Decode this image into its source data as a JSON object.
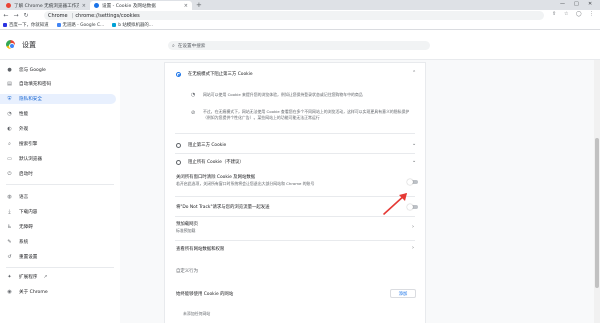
{
  "tabs": [
    {
      "label": "了解 Chrome 无痕浏览器工作方式",
      "close": "×"
    },
    {
      "label": "设置 - Cookie 及网站数据",
      "close": "×"
    }
  ],
  "new_tab": "+",
  "window_controls": {
    "minimize": "—",
    "maximize": "□",
    "close": "✕"
  },
  "toolbar": {
    "back": "←",
    "forward": "→",
    "reload": "↻",
    "chip": "Chrome",
    "separator": "|",
    "url": "chrome://settings/cookies"
  },
  "bookmarks": [
    {
      "label": "百度一下，你就知道",
      "color": "#2932e1"
    },
    {
      "label": "无道路 - Google C...",
      "color": "#4285f4"
    },
    {
      "label": "b 站模拟机器的...",
      "color": "#00a1d6"
    }
  ],
  "header": {
    "title": "设置",
    "search_placeholder": "在设置中搜索"
  },
  "sidebar": {
    "items": [
      {
        "label": "您与 Google",
        "icon": "person-icon",
        "glyph": "●"
      },
      {
        "label": "自动填充和密码",
        "icon": "clipboard-icon",
        "glyph": "▤"
      },
      {
        "label": "隐私和安全",
        "icon": "shield-icon",
        "glyph": "⛨"
      },
      {
        "label": "性能",
        "icon": "speed-icon",
        "glyph": "◔"
      },
      {
        "label": "外观",
        "icon": "palette-icon",
        "glyph": "◐"
      },
      {
        "label": "搜索引擎",
        "icon": "search-icon",
        "glyph": "⌕"
      },
      {
        "label": "默认浏览器",
        "icon": "browser-icon",
        "glyph": "▭"
      },
      {
        "label": "启动时",
        "icon": "power-icon",
        "glyph": "⏻"
      },
      {
        "label": "语言",
        "icon": "globe-icon",
        "glyph": "◍"
      },
      {
        "label": "下载内容",
        "icon": "download-icon",
        "glyph": "⤓"
      },
      {
        "label": "无障碍",
        "icon": "accessibility-icon",
        "glyph": "♿"
      },
      {
        "label": "系统",
        "icon": "wrench-icon",
        "glyph": "✎"
      },
      {
        "label": "重置设置",
        "icon": "reset-icon",
        "glyph": "↺"
      },
      {
        "label": "扩展程序",
        "icon": "puzzle-icon",
        "glyph": "✦",
        "external": "↗"
      },
      {
        "label": "关于 Chrome",
        "icon": "chrome-icon",
        "glyph": "◉"
      }
    ]
  },
  "main": {
    "option_incognito": "在无痕模式下阻止第三方 Cookie",
    "incognito_detail_1": "网站可以使用 Cookie 来提升您的浏览体验，例如让您保持登录状态或记住您购物车中的商品",
    "incognito_detail_2": "不过，在无痕模式下，网站无法使用 Cookie 查看您在多个不同网站上的浏览活动，这样可以实现更具有意义的隐私保护（例如为您提供个性化广告）。某些网站上的功能可能无法正常运行",
    "option_block_third": "阻止第三方 Cookie",
    "option_block_all": "阻止所有 Cookie（不建议）",
    "clear_on_exit_title": "关闭所有窗口时清除 Cookie 及网站数据",
    "clear_on_exit_sub": "若开启此选项，关闭所有窗口时系统将会让您退出大部分网站和 Chrome 的账号",
    "dnt_title": "将\"Do Not Track\"请求与您的浏览流量一起发送",
    "preload_title": "预加载网页",
    "preload_sub": "标准预加载",
    "all_site_data": "查看所有网站数据和权限",
    "custom_behavior": "自定义行为",
    "always_allow": "始终能够使用 Cookie 的网站",
    "add_button": "添加",
    "no_sites": "未添加任何网站",
    "chevron_up": "⌃",
    "chevron_down": "⌄",
    "chevron_right": "›"
  },
  "colors": {
    "accent": "#1a73e8",
    "arrow": "#e53935"
  }
}
